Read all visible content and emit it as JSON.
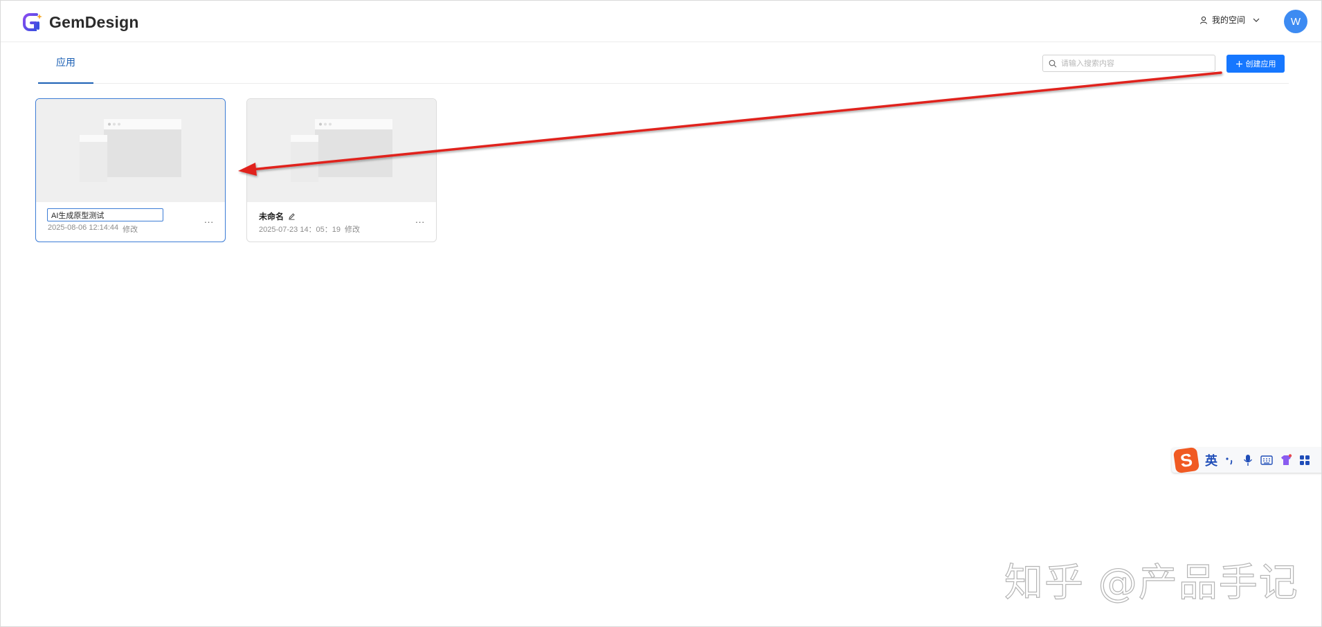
{
  "app": {
    "name": "GemDesign",
    "brand_colors": {
      "logo_blue": "#3b4fe0",
      "logo_purple": "#8a4cf0",
      "accent": "#1677ff"
    }
  },
  "header": {
    "space_label": "我的空间",
    "avatar_letter": "W"
  },
  "toolbar": {
    "tab_label": "应用",
    "search_placeholder": "请输入搜索内容",
    "create_label": "创建应用"
  },
  "cards": [
    {
      "name": "AI生成原型测试",
      "date": "2025-08-06 12:14:44",
      "action": "修改",
      "editing": true,
      "more": "..."
    },
    {
      "name": "未命名",
      "date": "2025-07-23 14：05：19",
      "action": "修改",
      "editing": false,
      "more": "..."
    }
  ],
  "ime": {
    "lang": "英",
    "logo": "S",
    "icons": [
      "punctuation-icon",
      "microphone-icon",
      "keyboard-icon",
      "skin-icon",
      "apps-icon"
    ]
  },
  "watermark": "知乎 @产品手记"
}
